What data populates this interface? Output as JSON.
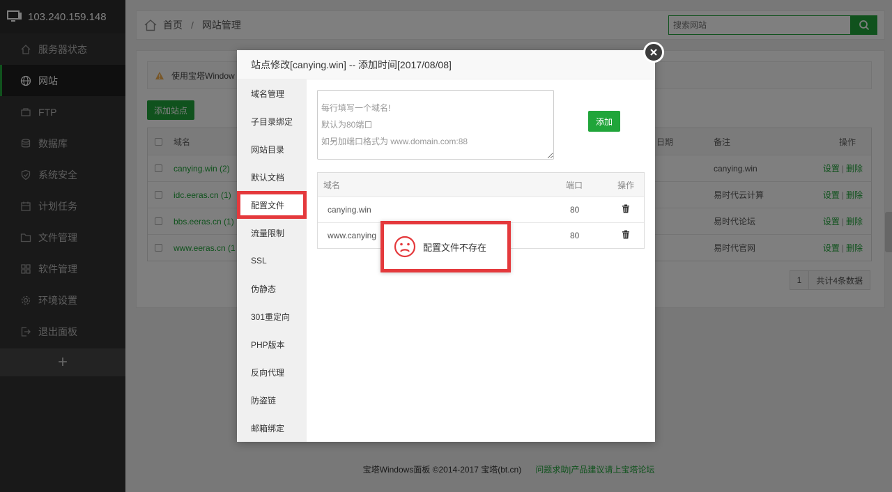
{
  "sidebar": {
    "ip": "103.240.159.148",
    "items": [
      {
        "label": "服务器状态",
        "icon": "home-icon"
      },
      {
        "label": "网站",
        "icon": "globe-icon"
      },
      {
        "label": "FTP",
        "icon": "ftp-icon"
      },
      {
        "label": "数据库",
        "icon": "database-icon"
      },
      {
        "label": "系统安全",
        "icon": "shield-icon"
      },
      {
        "label": "计划任务",
        "icon": "calendar-icon"
      },
      {
        "label": "文件管理",
        "icon": "folder-icon"
      },
      {
        "label": "软件管理",
        "icon": "grid-icon"
      },
      {
        "label": "环境设置",
        "icon": "gear-icon"
      },
      {
        "label": "退出面板",
        "icon": "logout-icon"
      }
    ],
    "add_label": "+"
  },
  "header": {
    "breadcrumb_home": "首页",
    "breadcrumb_sep": "/",
    "breadcrumb_current": "网站管理",
    "search_placeholder": "搜索网站"
  },
  "main": {
    "warning": "使用宝塔Window",
    "add_site_label": "添加站点",
    "columns": {
      "domain": "域名",
      "date": "日期",
      "note": "备注",
      "op": "操作"
    },
    "rows": [
      {
        "domain": "canying.win (2)",
        "note": "canying.win"
      },
      {
        "domain": "idc.eeras.cn (1)",
        "note": "易时代云计算"
      },
      {
        "domain": "bbs.eeras.cn (1)",
        "note": "易时代论坛"
      },
      {
        "domain": "www.eeras.cn (1",
        "note": "易时代官网"
      }
    ],
    "op_set": "设置",
    "op_sep": "|",
    "op_delete": "删除",
    "pager_page": "1",
    "pager_total": "共计4条数据"
  },
  "footer": {
    "copyright": "宝塔Windows面板 ©2014-2017 宝塔(bt.cn)",
    "link": "问题求助|产品建议请上宝塔论坛"
  },
  "modal": {
    "title": "站点修改[canying.win] -- 添加时间[2017/08/08]",
    "nav": [
      "域名管理",
      "子目录绑定",
      "网站目录",
      "默认文档",
      "配置文件",
      "流量限制",
      "SSL",
      "伪静态",
      "301重定向",
      "PHP版本",
      "反向代理",
      "防盗链",
      "邮箱绑定"
    ],
    "textarea_placeholder": [
      "每行填写一个域名!",
      "默认为80端口",
      "如另加端口格式为 www.domain.com:88"
    ],
    "add_button": "添加",
    "table_headers": {
      "domain": "域名",
      "port": "端口",
      "op": "操作"
    },
    "domains": [
      {
        "name": "canying.win",
        "port": "80"
      },
      {
        "name": "www.canying",
        "port": "80"
      }
    ]
  },
  "toast": {
    "message": "配置文件不存在"
  }
}
